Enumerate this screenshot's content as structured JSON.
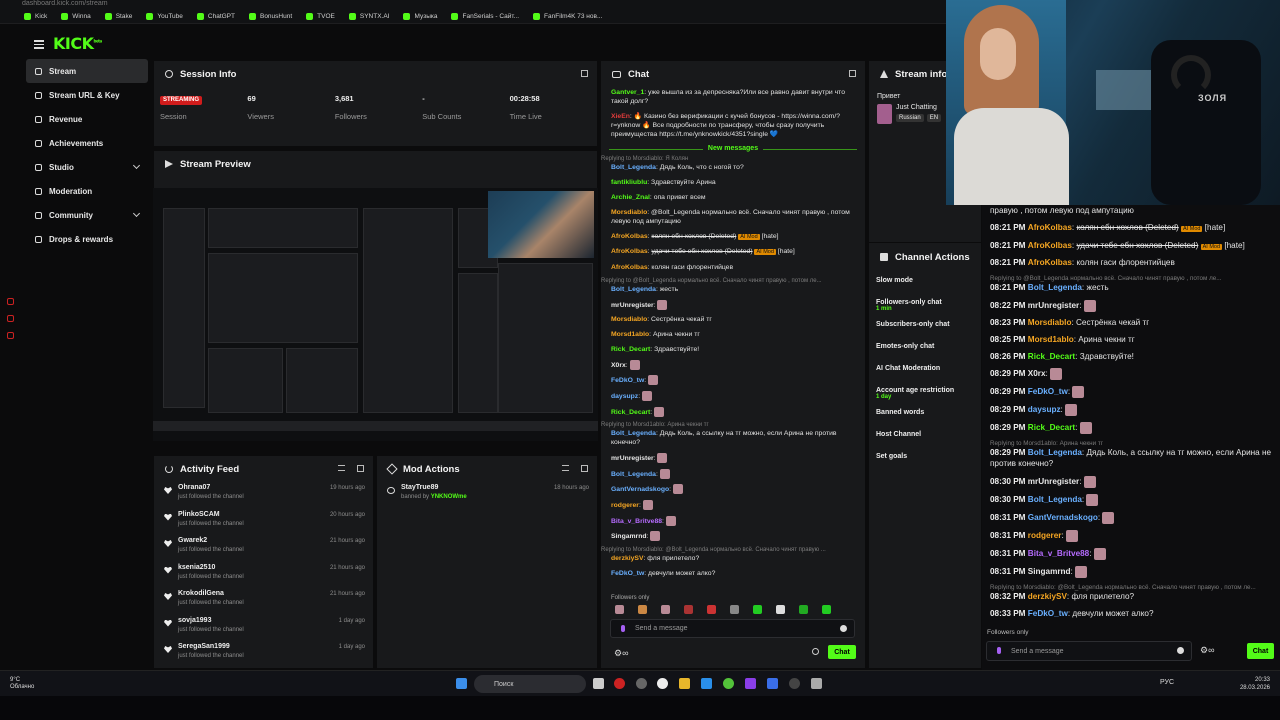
{
  "browser": {
    "url": "dashboard.kick.com/stream",
    "bookmarks": [
      "Kick",
      "Winna",
      "Stake",
      "YouTube",
      "ChatGPT",
      "BonusHunt",
      "TVOE",
      "SYNTX.AI",
      "Музыка",
      "FanSerials - Сайт...",
      "FanFilm4K 73 нов..."
    ]
  },
  "app": {
    "logo": "KICK",
    "logo_sup": "beta"
  },
  "sidebar": {
    "items": [
      {
        "label": "Stream"
      },
      {
        "label": "Stream URL & Key"
      },
      {
        "label": "Revenue"
      },
      {
        "label": "Achievements"
      },
      {
        "label": "Studio"
      },
      {
        "label": "Moderation"
      },
      {
        "label": "Community"
      },
      {
        "label": "Drops & rewards"
      }
    ]
  },
  "session": {
    "title": "Session Info",
    "status": "STREAMING",
    "status_label": "Session",
    "stats": [
      {
        "value": "69",
        "label": "Viewers"
      },
      {
        "value": "3,681",
        "label": "Followers"
      },
      {
        "value": "-",
        "label": "Sub Counts"
      },
      {
        "value": "00:28:58",
        "label": "Time Live"
      }
    ]
  },
  "preview": {
    "title": "Stream Preview"
  },
  "activity": {
    "title": "Activity Feed",
    "items": [
      {
        "name": "Ohrana07",
        "desc": "just followed the channel",
        "time": "19 hours ago"
      },
      {
        "name": "PlinkoSCAM",
        "desc": "just followed the channel",
        "time": "20 hours ago"
      },
      {
        "name": "Gwarek2",
        "desc": "just followed the channel",
        "time": "21 hours ago"
      },
      {
        "name": "ksenia2510",
        "desc": "just followed the channel",
        "time": "21 hours ago"
      },
      {
        "name": "KrokodilGena",
        "desc": "just followed the channel",
        "time": "21 hours ago"
      },
      {
        "name": "sovja1993",
        "desc": "just followed the channel",
        "time": "1 day ago"
      },
      {
        "name": "SeregaSan1999",
        "desc": "just followed the channel",
        "time": "1 day ago"
      }
    ]
  },
  "mod_actions": {
    "title": "Mod Actions",
    "items": [
      {
        "name": "StayTrue89",
        "desc_prefix": "banned by",
        "by": "YNKNOWme",
        "time": "18 hours ago"
      }
    ]
  },
  "chat": {
    "title": "Chat",
    "new_messages": "New messages",
    "followers_only": "Followers only",
    "placeholder": "Send a message",
    "send": "Chat",
    "messages": [
      {
        "user": "Gantver_1",
        "color": "#53fc18",
        "text": "уже вышла из за депресняка?Или все равно давит внутри что такой долг?"
      },
      {
        "user": "XieEn",
        "color": "#e03b3b",
        "text": "🔥 Казино без верификации с кучей бонусов - https://winna.com/?r=ynknow 🔥 Все подробности по трансферу, чтобы сразу получить преимущества https://t.me/ynknowkick/4351?single 💙"
      },
      {
        "user": "Bolt_Legenda",
        "color": "#6ab0ff",
        "text": "Дядь Коль, что с ногой то?",
        "reply": "Replying to Morsdiablo: Я Колян"
      },
      {
        "user": "fantikliublu",
        "color": "#53fc18",
        "text": "Здравствуйте Арина"
      },
      {
        "user": "Archie_Znal",
        "color": "#53fc18",
        "text": "опа привет всем"
      },
      {
        "user": "Morsdiablo",
        "color": "#f5a623",
        "text": "@Bolt_Legenda нормально всё. Сначало чинят правую , потом левую под ампутацию"
      },
      {
        "user": "AfroKolbas",
        "color": "#f5a623",
        "text": "колян ебн хохлов (Deleted)",
        "badge": "AI Mod",
        "tag": "[hate]"
      },
      {
        "user": "AfroKolbas",
        "color": "#f5a623",
        "text": "удачи тебе ебн хохлов (Deleted)",
        "badge": "AI Mod",
        "tag": "[hate]"
      },
      {
        "user": "AfroKolbas",
        "color": "#f5a623",
        "text": "колян гаси флорентийцев"
      },
      {
        "user": "Bolt_Legenda",
        "color": "#6ab0ff",
        "text": "жесть",
        "reply": "Replying to @Bolt_Legenda нормально всё. Сначало чинят правую , потом ле..."
      },
      {
        "user": "mrUnregister",
        "color": "#e8e8e8",
        "text": ""
      },
      {
        "user": "Morsdiablo",
        "color": "#f5a623",
        "text": "Сестрёнка чекай тг"
      },
      {
        "user": "Morsd1ablo",
        "color": "#f5a623",
        "text": "Арина чекни тг"
      },
      {
        "user": "Rick_Decart",
        "color": "#53fc18",
        "text": "Здравствуйте!"
      },
      {
        "user": "X0rx",
        "color": "#e8e8e8",
        "text": ""
      },
      {
        "user": "FeDkO_tw",
        "color": "#6ab0ff",
        "text": ""
      },
      {
        "user": "daysupz",
        "color": "#6ab0ff",
        "text": ""
      },
      {
        "user": "Rick_Decart",
        "color": "#53fc18",
        "text": ""
      },
      {
        "user": "Bolt_Legenda",
        "color": "#6ab0ff",
        "text": "Дядь Коль, а ссылку на тг можно, если Арина не против конечно?",
        "reply": "Replying to Morsd1ablo: Арина чекни тг"
      },
      {
        "user": "mrUnregister",
        "color": "#e8e8e8",
        "text": ""
      },
      {
        "user": "Bolt_Legenda",
        "color": "#6ab0ff",
        "text": ""
      },
      {
        "user": "GantVernadskogo",
        "color": "#6ab0ff",
        "text": ""
      },
      {
        "user": "rodgerer",
        "color": "#f5a623",
        "text": ""
      },
      {
        "user": "Bita_v_Britve88",
        "color": "#b66cff",
        "text": ""
      },
      {
        "user": "Singamrnd",
        "color": "#e8e8e8",
        "text": ""
      },
      {
        "user": "derzkiySV",
        "color": "#f5a623",
        "text": "фля прилетело?",
        "reply": "Replying to Morsdiablo: @Bolt_Legenda нормально всё. Сначало чинят правую ..."
      },
      {
        "user": "FeDkO_tw",
        "color": "#6ab0ff",
        "text": "девчули может алко?"
      }
    ]
  },
  "stream_info": {
    "title": "Stream info",
    "greeting": "Привет",
    "category": "Just Chatting",
    "tags": [
      "Russian",
      "EN"
    ]
  },
  "channel_actions": {
    "title": "Channel Actions",
    "items": [
      {
        "label": "Slow mode"
      },
      {
        "label": "Followers-only chat",
        "sub": "1 min"
      },
      {
        "label": "Subscribers-only chat"
      },
      {
        "label": "Emotes-only chat"
      },
      {
        "label": "AI Chat Moderation"
      },
      {
        "label": "Account age restriction",
        "sub": "1 day"
      },
      {
        "label": "Banned words"
      },
      {
        "label": "Host Channel"
      },
      {
        "label": "Set goals"
      }
    ]
  },
  "webcam": {
    "tag": "ЗОЛЯ"
  },
  "overlay_chat": {
    "followers_only": "Followers only",
    "placeholder": "Send a message",
    "send": "Chat",
    "messages": [
      {
        "time": "",
        "user": "",
        "color": "#e4e4e4",
        "text": "правую , потом левую под ампутацию"
      },
      {
        "time": "08:21 PM",
        "user": "AfroKolbas",
        "color": "#f5a623",
        "text": "колян ебн хохлов (Deleted)",
        "badge": "AI Mod",
        "tag": "[hate]"
      },
      {
        "time": "08:21 PM",
        "user": "AfroKolbas",
        "color": "#f5a623",
        "text": "удачи тебе ебн хохлов (Deleted)",
        "badge": "AI Mod",
        "tag": "[hate]"
      },
      {
        "time": "08:21 PM",
        "user": "AfroKolbas",
        "color": "#f5a623",
        "text": "колян гаси флорентийцев"
      },
      {
        "time": "08:21 PM",
        "user": "Bolt_Legenda",
        "color": "#6ab0ff",
        "text": "жесть",
        "reply": "Replying to @Bolt_Legenda нормально всё. Сначало чинят правую , потом ле..."
      },
      {
        "time": "08:22 PM",
        "user": "mrUnregister",
        "color": "#e8e8e8",
        "text": ""
      },
      {
        "time": "08:23 PM",
        "user": "Morsdiablo",
        "color": "#f5a623",
        "text": "Сестрёнка чекай тг"
      },
      {
        "time": "08:25 PM",
        "user": "Morsd1ablo",
        "color": "#f5a623",
        "text": "Арина чекни тг"
      },
      {
        "time": "08:26 PM",
        "user": "Rick_Decart",
        "color": "#53fc18",
        "text": "Здравствуйте!"
      },
      {
        "time": "08:29 PM",
        "user": "X0rx",
        "color": "#e8e8e8",
        "text": ""
      },
      {
        "time": "08:29 PM",
        "user": "FeDkO_tw",
        "color": "#6ab0ff",
        "text": ""
      },
      {
        "time": "08:29 PM",
        "user": "daysupz",
        "color": "#6ab0ff",
        "text": ""
      },
      {
        "time": "08:29 PM",
        "user": "Rick_Decart",
        "color": "#53fc18",
        "text": ""
      },
      {
        "time": "08:29 PM",
        "user": "Bolt_Legenda",
        "color": "#6ab0ff",
        "text": "Дядь Коль, а ссылку на тг можно, если Арина не против конечно?",
        "reply": "Replying to Morsd1ablo: Арина чекни тг"
      },
      {
        "time": "08:30 PM",
        "user": "mrUnregister",
        "color": "#e8e8e8",
        "text": ""
      },
      {
        "time": "08:30 PM",
        "user": "Bolt_Legenda",
        "color": "#6ab0ff",
        "text": ""
      },
      {
        "time": "08:31 PM",
        "user": "GantVernadskogo",
        "color": "#6ab0ff",
        "text": ""
      },
      {
        "time": "08:31 PM",
        "user": "rodgerer",
        "color": "#f5a623",
        "text": ""
      },
      {
        "time": "08:31 PM",
        "user": "Bita_v_Britve88",
        "color": "#b66cff",
        "text": ""
      },
      {
        "time": "08:31 PM",
        "user": "Singamrnd",
        "color": "#e8e8e8",
        "text": ""
      },
      {
        "time": "08:32 PM",
        "user": "derzkiySV",
        "color": "#f5a623",
        "text": "фля прилетело?",
        "reply": "Replying to Morsdiablo: @Bolt_Legenda нормально всё. Сначало чинят правую , потом ле..."
      },
      {
        "time": "08:33 PM",
        "user": "FeDkO_tw",
        "color": "#6ab0ff",
        "text": "девчули может алко?"
      }
    ]
  },
  "taskbar": {
    "weather_temp": "9°C",
    "weather_desc": "Облачно",
    "search": "Поиск",
    "lang": "РУС",
    "time": "20:33",
    "date": "28.03.2026"
  }
}
